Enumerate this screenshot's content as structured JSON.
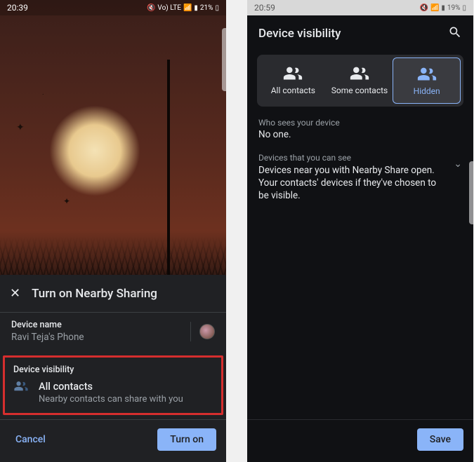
{
  "left": {
    "status": {
      "time": "20:39",
      "networkText": "Vo) LTE",
      "battery": "21%"
    },
    "sheet": {
      "title": "Turn on Nearby Sharing",
      "deviceName": {
        "label": "Device name",
        "value": "Ravi Teja's Phone"
      },
      "visibility": {
        "label": "Device visibility",
        "mode": "All contacts",
        "description": "Nearby contacts can share with you"
      },
      "actions": {
        "cancel": "Cancel",
        "confirm": "Turn on"
      }
    }
  },
  "right": {
    "status": {
      "time": "20:59",
      "battery": "19%"
    },
    "title": "Device visibility",
    "segments": {
      "all": "All contacts",
      "some": "Some contacts",
      "hidden": "Hidden",
      "selected": "hidden"
    },
    "whoSees": {
      "caption": "Who sees your device",
      "body": "No one."
    },
    "devicesYouSee": {
      "caption": "Devices that you can see",
      "body": "Devices near you with Nearby Share open. Your contacts' devices if they've chosen to be visible."
    },
    "save": "Save"
  }
}
